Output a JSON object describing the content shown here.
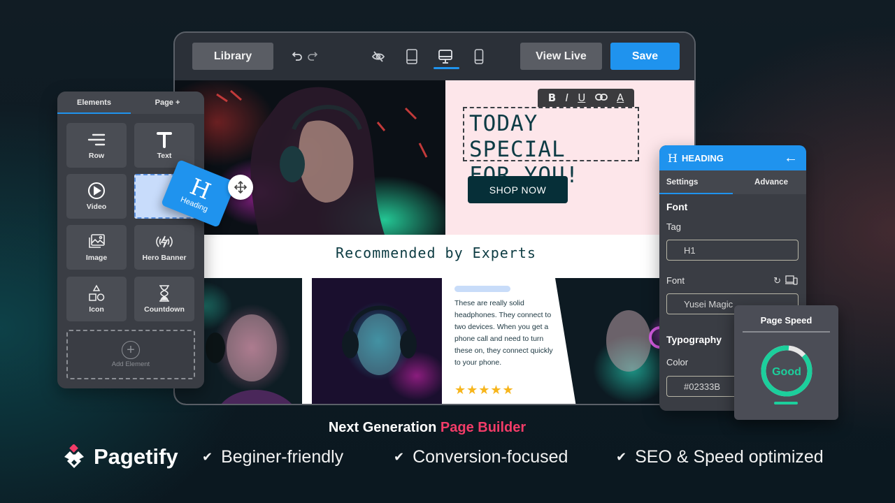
{
  "toolbar": {
    "library_label": "Library",
    "undo_icon": "undo-icon",
    "redo_icon": "redo-icon",
    "devices": [
      {
        "name": "hide-icon",
        "active": false
      },
      {
        "name": "tablet-icon",
        "active": false
      },
      {
        "name": "desktop-icon",
        "active": true
      },
      {
        "name": "mobile-icon",
        "active": false
      }
    ],
    "view_live_label": "View Live",
    "save_label": "Save"
  },
  "canvas": {
    "hero": {
      "format_bar": [
        "B",
        "I",
        "U",
        "link",
        "A"
      ],
      "heading_line1": "TODAY SPECIAL",
      "heading_line2": "FOR YOU!",
      "cta_label": "SHOP NOW"
    },
    "section_title": "Recommended by Experts",
    "review": {
      "text": "These are really solid headphones. They connect to two devices. When you get a phone call and need to turn these on, they connect quickly to your phone.",
      "rating": 5,
      "stars": "★★★★★"
    }
  },
  "elements_panel": {
    "tabs": [
      {
        "label": "Elements",
        "active": true
      },
      {
        "label": "Page +",
        "active": false
      }
    ],
    "items": [
      {
        "label": "Row",
        "icon": "row-icon"
      },
      {
        "label": "Text",
        "icon": "text-icon"
      },
      {
        "label": "Video",
        "icon": "video-icon"
      },
      {
        "label": "",
        "icon": "drop-placeholder"
      },
      {
        "label": "Image",
        "icon": "image-icon"
      },
      {
        "label": "Hero Banner",
        "icon": "hero-banner-icon"
      },
      {
        "label": "Icon",
        "icon": "shapes-icon"
      },
      {
        "label": "Countdown",
        "icon": "hourglass-icon"
      }
    ],
    "add_element_label": "Add Element"
  },
  "drag_card": {
    "glyph": "H",
    "label": "Heading"
  },
  "settings_panel": {
    "title": "HEADING",
    "tabs": [
      {
        "label": "Settings",
        "active": true
      },
      {
        "label": "Advance",
        "active": false
      }
    ],
    "font_section": "Font",
    "tag_label": "Tag",
    "tag_value": "H1",
    "font_label": "Font",
    "font_value": "Yusei Magic",
    "typography_section": "Typography",
    "color_label": "Color",
    "color_value": "#02333B"
  },
  "page_speed": {
    "title": "Page Speed",
    "status": "Good",
    "score_fraction": 0.88,
    "color": "#1ccf9c"
  },
  "footer": {
    "tagline_prefix": "Next Generation ",
    "tagline_accent": "Page Builder",
    "brand": "Pagetify",
    "features": [
      "Beginer-friendly",
      "Conversion-focused",
      "SEO & Speed optimized"
    ]
  },
  "colors": {
    "accent_blue": "#1f93ee",
    "accent_pink": "#f23c68",
    "heading_color": "#02333B",
    "good_green": "#1ccf9c"
  }
}
